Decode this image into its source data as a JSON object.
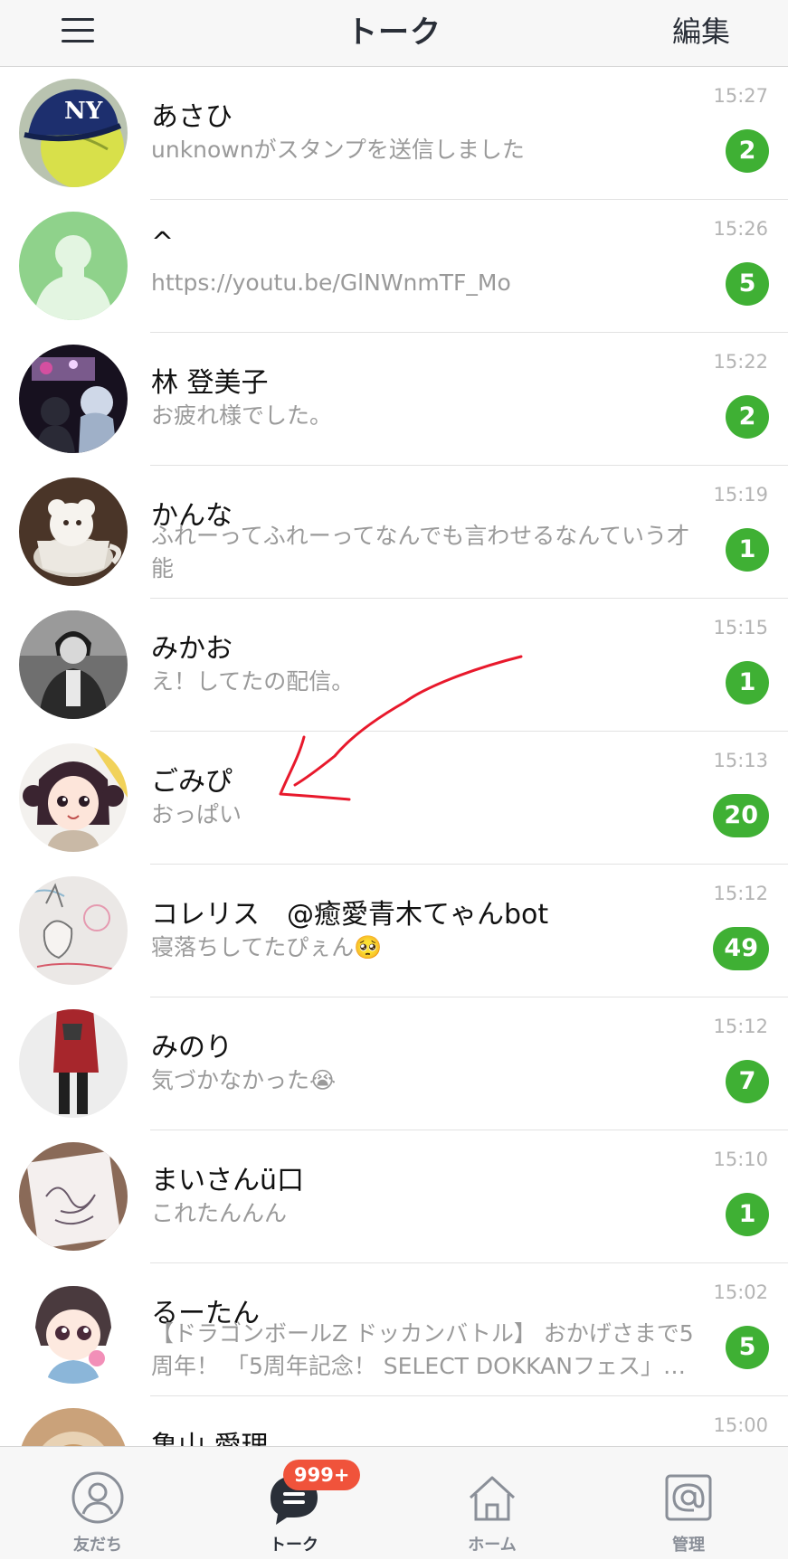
{
  "header": {
    "title": "トーク",
    "edit_label": "編集"
  },
  "chats": [
    {
      "name": "あさひ",
      "message": "unknownがスタンプを送信しました",
      "time": "15:27",
      "unread": "2",
      "avatar_icon": "cap-on-ball-photo"
    },
    {
      "name": "^",
      "message": "https://youtu.be/GlNWnmTF_Mo",
      "time": "15:26",
      "unread": "5",
      "avatar_icon": "default-person-icon"
    },
    {
      "name": "林 登美子",
      "message": "お疲れ様でした。",
      "time": "15:22",
      "unread": "2",
      "avatar_icon": "night-scene-photo"
    },
    {
      "name": "かんな",
      "message": "ふれーってふれーってなんでも言わせるなんていう才能",
      "time": "15:19",
      "unread": "1",
      "avatar_icon": "latte-art-photo"
    },
    {
      "name": "みかお",
      "message": "え！してたの配信。",
      "time": "15:15",
      "unread": "1",
      "avatar_icon": "monochrome-portrait-photo"
    },
    {
      "name": "ごみぴ",
      "message": "おっぱい",
      "time": "15:13",
      "unread": "20",
      "avatar_icon": "anime-girl-illustration"
    },
    {
      "name": "コレリス　@癒愛青木てゃんbot",
      "message": "寝落ちしてたぴぇん🥺",
      "time": "15:12",
      "unread": "49",
      "avatar_icon": "sketch-illustration"
    },
    {
      "name": "みのり",
      "message": "気づかなかった😭",
      "time": "15:12",
      "unread": "7",
      "avatar_icon": "red-jacket-photo"
    },
    {
      "name": "まいさんü口",
      "message": "これたんんん",
      "time": "15:10",
      "unread": "1",
      "avatar_icon": "signature-photo"
    },
    {
      "name": "るーたん",
      "message": "【ドラゴンボールZ ドッカンバトル】 おかげさまで5周年！ 「5周年記念！ SELECT DOKKANフェス」開催",
      "time": "15:02",
      "unread": "5",
      "avatar_icon": "chibi-anime-illustration"
    },
    {
      "name": "亀山 愛理",
      "message": "",
      "time": "15:00",
      "unread": "",
      "avatar_icon": "coffee-photo"
    }
  ],
  "tabbar": {
    "tabs": [
      {
        "label": "友だち",
        "icon": "person-icon"
      },
      {
        "label": "トーク",
        "icon": "chat-bubble-icon"
      },
      {
        "label": "ホーム",
        "icon": "home-icon"
      },
      {
        "label": "管理",
        "icon": "at-sign-icon"
      }
    ],
    "badge": "999+"
  },
  "colors": {
    "badge_green": "#3fb034",
    "badge_red": "#f0533b",
    "annotation_red": "#e8192c"
  }
}
